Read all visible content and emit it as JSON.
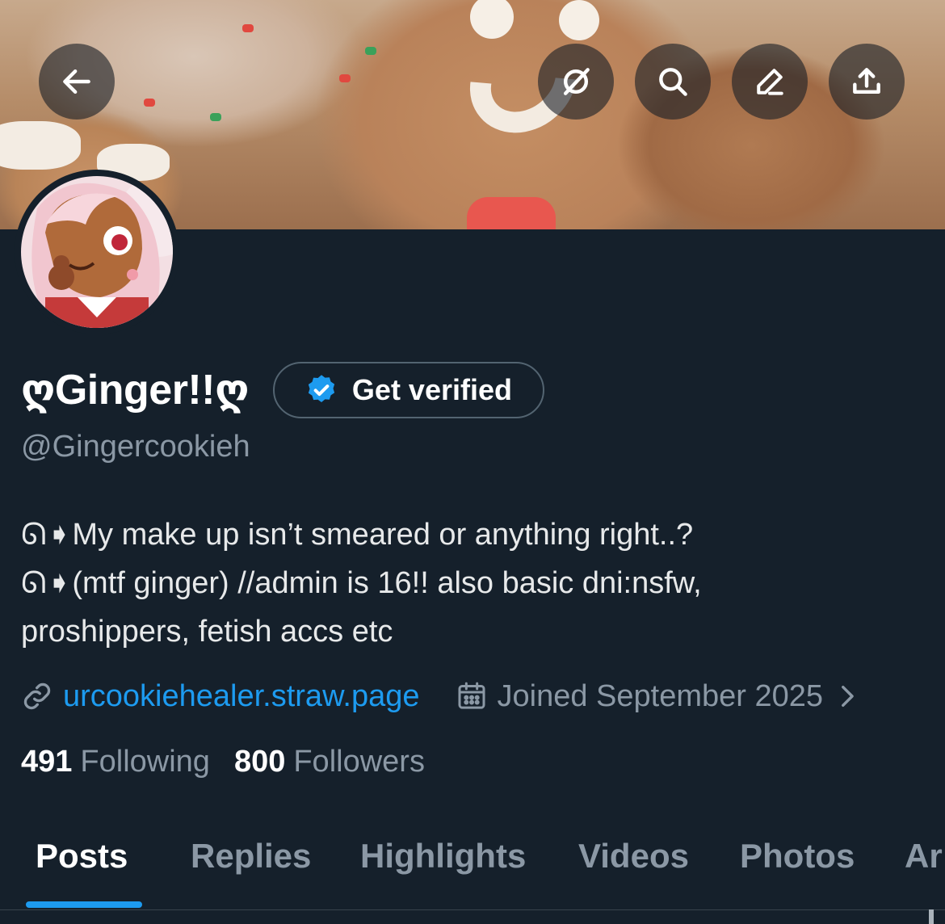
{
  "colors": {
    "background": "#15202b",
    "accent": "#1d9bf0",
    "secondary_text": "#8b98a5",
    "primary_text": "#e7e9ea",
    "verified_badge": "#1d9bf0"
  },
  "header": {
    "back_icon": "arrow-left-icon",
    "actions": [
      "grok-icon",
      "search-icon",
      "edit-icon",
      "share-icon"
    ]
  },
  "profile": {
    "display_name": "ღGinger!!ღ",
    "verify_button_label": "Get verified",
    "handle": "@Gingercookieh",
    "bio_lines": [
      "ᘏ➧My make up isn’t smeared or anything right..?",
      "ᘏ➧(mtf ginger) //admin is 16!! also basic dni:nsfw,",
      "proshippers, fetish accs etc"
    ],
    "website": "urcookiehealer.straw.page",
    "joined": "Joined September 2025",
    "following_count": "491",
    "following_label": "Following",
    "followers_count": "800",
    "followers_label": "Followers"
  },
  "tabs": [
    "Posts",
    "Replies",
    "Highlights",
    "Videos",
    "Photos",
    "Ar"
  ],
  "active_tab": "Posts"
}
